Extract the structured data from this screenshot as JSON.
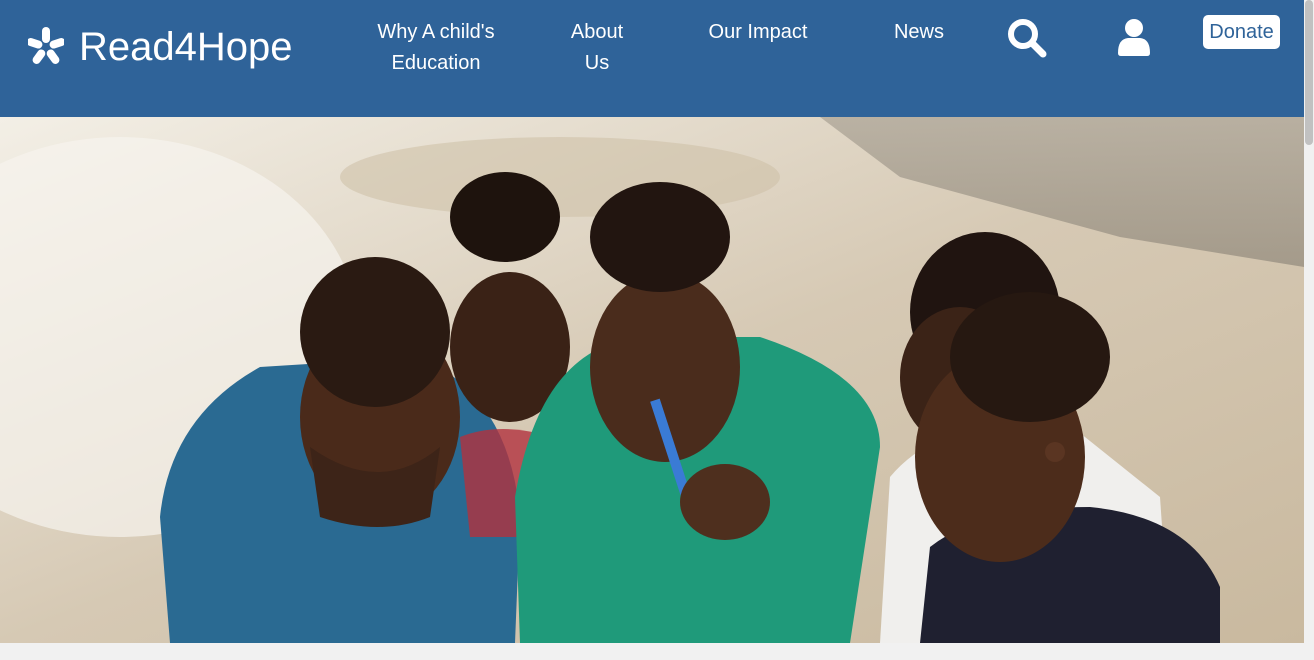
{
  "brand": {
    "name": "Read4Hope",
    "icon": "yelp-burst-icon"
  },
  "nav": {
    "why_line1": "Why A child's",
    "why_line2": "Education",
    "about_line1": "About",
    "about_line2": "Us",
    "impact": "Our Impact",
    "news": "News"
  },
  "actions": {
    "search_icon": "search-icon",
    "account_icon": "user-icon",
    "donate": "Donate"
  },
  "hero": {
    "image": "children-reading-together-photo"
  },
  "colors": {
    "nav_bg": "#2f6399",
    "text": "#ffffff",
    "page_bg": "#f1f1f1"
  }
}
